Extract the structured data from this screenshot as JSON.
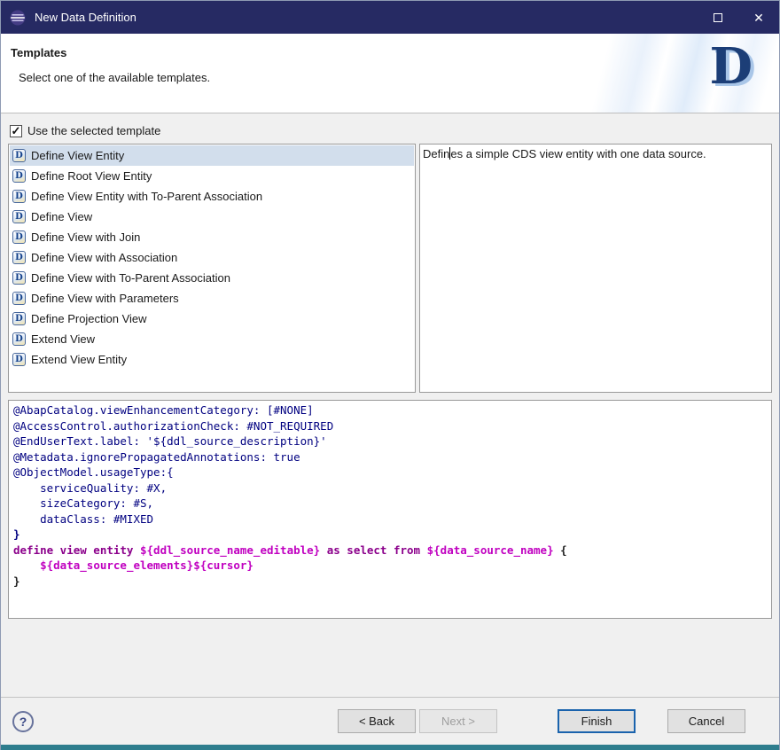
{
  "colors": {
    "titlebar": "#262a63",
    "bottom-band": "#2e7d8d",
    "selection": "#d2deec",
    "code-ann": "#000080",
    "code-kw": "#8b008b",
    "code-var": "#c000c0",
    "default-btn": "#1a63ad"
  },
  "window": {
    "title": "New Data Definition",
    "close_glyph": "✕"
  },
  "header": {
    "title": "Templates",
    "subtitle": "Select one of the available templates.",
    "logo_letter": "D"
  },
  "template_section": {
    "use_template_label": "Use the selected template",
    "checkbox_checked": true,
    "check_glyph": "✓",
    "icon_glyph": "D",
    "selected_index": 0,
    "items": [
      "Define View Entity",
      "Define Root View Entity",
      "Define View Entity with To-Parent Association",
      "Define View",
      "Define View with Join",
      "Define View with Association",
      "Define View with To-Parent Association",
      "Define View with Parameters",
      "Define Projection View",
      "Extend View",
      "Extend View Entity"
    ],
    "description": "Defines a simple CDS view entity with one data source.",
    "description_cursor_index": 5
  },
  "code_preview": {
    "lines": [
      [
        {
          "t": "@AbapCatalog.viewEnhancementCategory: [#NONE]",
          "c": "ann"
        }
      ],
      [
        {
          "t": "@AccessControl.authorizationCheck: #NOT_REQUIRED",
          "c": "ann"
        }
      ],
      [
        {
          "t": "@EndUserText.label: '${ddl_source_description}'",
          "c": "ann"
        }
      ],
      [
        {
          "t": "@Metadata.ignorePropagatedAnnotations: true",
          "c": "ann"
        }
      ],
      [
        {
          "t": "@ObjectModel.usageType:{",
          "c": "ann"
        }
      ],
      [
        {
          "t": "    serviceQuality: #X,",
          "c": "ann"
        }
      ],
      [
        {
          "t": "    sizeCategory: #S,",
          "c": "ann"
        }
      ],
      [
        {
          "t": "    dataClass: #MIXED",
          "c": "ann"
        }
      ],
      [
        {
          "t": "}",
          "c": "annb"
        }
      ],
      [
        {
          "t": "define view entity ",
          "c": "kw"
        },
        {
          "t": "${ddl_source_name_editable}",
          "c": "var"
        },
        {
          "t": " as select from ",
          "c": "kw"
        },
        {
          "t": "${data_source_name}",
          "c": "var"
        },
        {
          "t": " {",
          "c": "plainb"
        }
      ],
      [
        {
          "t": "    ",
          "c": "plain"
        },
        {
          "t": "${data_source_elements}${cursor}",
          "c": "var"
        }
      ],
      [
        {
          "t": "}",
          "c": "plainb"
        }
      ]
    ]
  },
  "footer": {
    "help_glyph": "?",
    "buttons": [
      {
        "name": "back-button",
        "label": "< Back",
        "enabled": true,
        "default": false
      },
      {
        "name": "next-button",
        "label": "Next >",
        "enabled": false,
        "default": false
      },
      {
        "name": "finish-button",
        "label": "Finish",
        "enabled": true,
        "default": true
      },
      {
        "name": "cancel-button",
        "label": "Cancel",
        "enabled": true,
        "default": false
      }
    ]
  }
}
